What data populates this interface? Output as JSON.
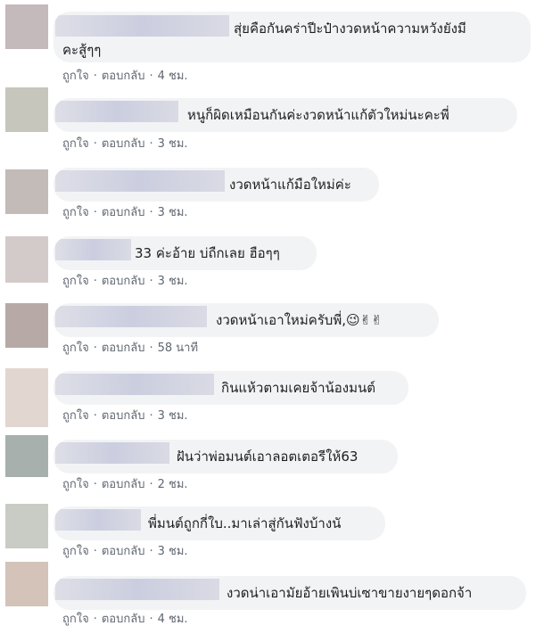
{
  "actions": {
    "like": "ถูกใจ",
    "reply": "ตอบกลับ",
    "separator": "·"
  },
  "comments": [
    {
      "text": "สุ่ยคือกันคร่าปีะป๋างวดหน้าความหวังยังมี\nคะสู้ๆๆ",
      "time": "4 ชม.",
      "avatar_color": "#c4b9bb"
    },
    {
      "text": "หนูก็ผิดเหมือนกันค่ะงวดหน้าแก้ตัวใหม่นะคะพี่",
      "time": "3 ชม.",
      "avatar_color": "#c7c6bd"
    },
    {
      "text": "งวดหน้าแก้มือใหม่ค่ะ",
      "time": "3 ชม.",
      "avatar_color": "#c2bbb7"
    },
    {
      "text": "33 ค่ะอ้าย บ่ถืกเลย ฮือๆๆ",
      "time": "3 ชม.",
      "avatar_color": "#d2cbc9"
    },
    {
      "text": "งวดหน้าเอาใหม่ครับพี่,😉✌✌",
      "time": "58 นาที",
      "avatar_color": "#b7aaa6"
    },
    {
      "text": "กินแห้วตามเคยจ้าน้องมนต์",
      "time": "3 ชม.",
      "avatar_color": "#e2d6d1"
    },
    {
      "text": "ฝันว่าพ่อมนต์เอาลอตเตอรีให้63",
      "time": "2 ชม.",
      "avatar_color": "#a7b0ad"
    },
    {
      "text": "พี่มนต์ถูกกี่ใบ..มาเล่าสู่กันฟังบ้างนั",
      "time": "3 ชม.",
      "avatar_color": "#c9ccc4"
    },
    {
      "text": "งวดน่าเอามัยอ้ายเพินบ่เซาขายงายๆดอกจ้า",
      "time": "4 ชม.",
      "avatar_color": "#d3c3b8"
    }
  ]
}
